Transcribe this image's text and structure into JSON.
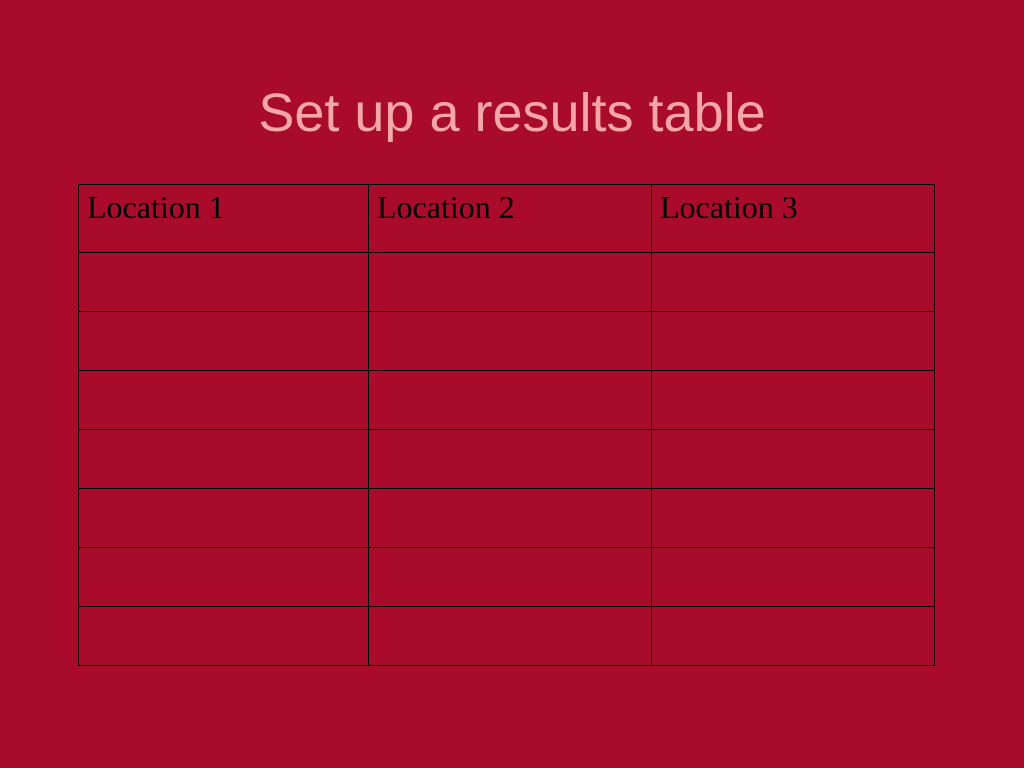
{
  "title": "Set up a results table",
  "table": {
    "headers": [
      "Location 1",
      "Location 2",
      "Location 3"
    ],
    "rows": [
      [
        "",
        "",
        ""
      ],
      [
        "",
        "",
        ""
      ],
      [
        "",
        "",
        ""
      ],
      [
        "",
        "",
        ""
      ],
      [
        "",
        "",
        ""
      ],
      [
        "",
        "",
        ""
      ],
      [
        "",
        "",
        ""
      ]
    ]
  }
}
